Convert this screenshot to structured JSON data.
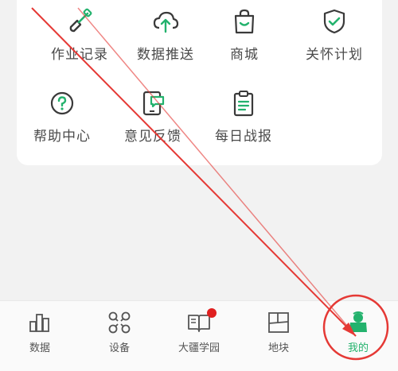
{
  "colors": {
    "accent_green": "#23b26d",
    "icon_gray": "#3a3a3a",
    "badge_red": "#e02020",
    "annotation_red": "#e53935"
  },
  "menu": {
    "items": [
      {
        "label": "作业记录",
        "icon": "shovel-icon"
      },
      {
        "label": "数据推送",
        "icon": "cloud-upload-icon"
      },
      {
        "label": "商城",
        "icon": "shopping-bag-icon"
      },
      {
        "label": "关怀计划",
        "icon": "shield-check-icon"
      },
      {
        "label": "帮助中心",
        "icon": "help-circle-icon"
      },
      {
        "label": "意见反馈",
        "icon": "feedback-phone-icon"
      },
      {
        "label": "每日战报",
        "icon": "clipboard-report-icon"
      }
    ]
  },
  "tabbar": {
    "tabs": [
      {
        "label": "数据",
        "icon": "bar-chart-icon",
        "active": false,
        "badge": false
      },
      {
        "label": "设备",
        "icon": "drone-icon",
        "active": false,
        "badge": false
      },
      {
        "label": "大疆学园",
        "icon": "book-icon",
        "active": false,
        "badge": true
      },
      {
        "label": "地块",
        "icon": "map-plot-icon",
        "active": false,
        "badge": false
      },
      {
        "label": "我的",
        "icon": "user-icon",
        "active": true,
        "badge": false
      }
    ]
  }
}
